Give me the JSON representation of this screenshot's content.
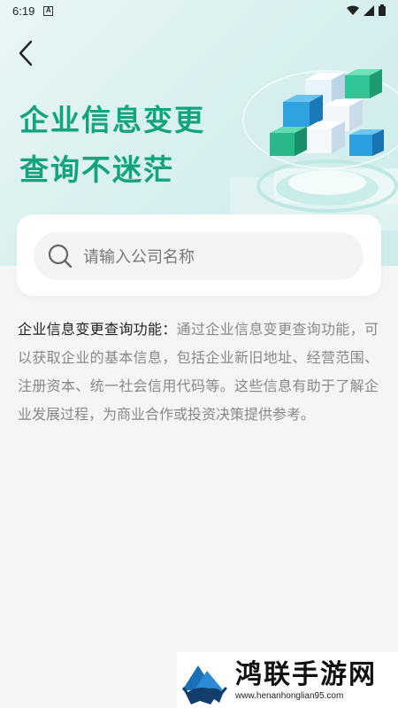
{
  "status_bar": {
    "time": "6:19",
    "notification_icon": "a-box-icon",
    "icons": [
      "wifi-icon",
      "signal-icon",
      "battery-icon"
    ]
  },
  "header": {
    "back_icon": "chevron-left-icon",
    "title_line1": "企业信息变更",
    "title_line2": "查询不迷茫"
  },
  "search": {
    "placeholder": "请输入公司名称",
    "icon": "search-icon"
  },
  "description": {
    "heading": "企业信息变更查询功能：",
    "body": "通过企业信息变更查询功能，可以获取企业的基本信息，包括企业新旧地址、经营范围、注册资本、统一社会信用代码等。这些信息有助于了解企业发展过程，为商业合作或投资决策提供参考。"
  },
  "watermark": {
    "name": "鸿联手游网",
    "url": "www.henanhonglian95.com"
  },
  "colors": {
    "accent": "#13a37f",
    "hero_bg": "#d9f0ef",
    "page_bg": "#f4f5f6"
  }
}
